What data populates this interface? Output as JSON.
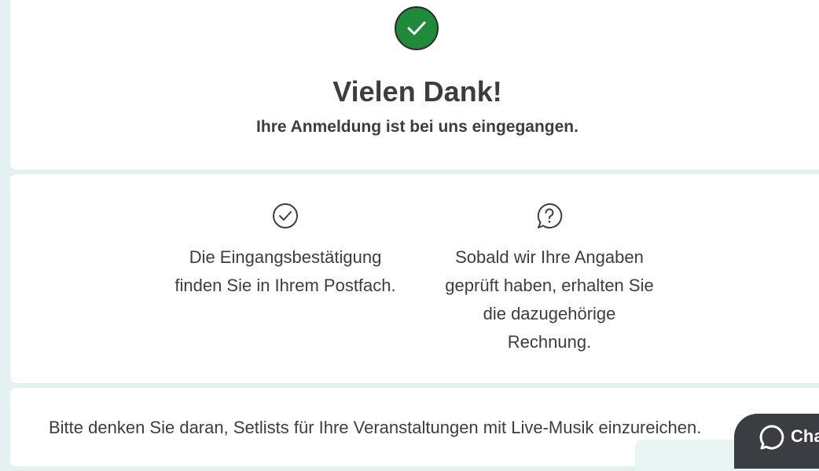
{
  "confirmation": {
    "title": "Vielen Dank!",
    "subtitle": "Ihre Anmeldung ist bei uns eingegangen.",
    "status_icon": "check-circle",
    "status_color": "#1e8a3a"
  },
  "info": [
    {
      "icon": "check-circle-outline",
      "text": "Die Eingangsbestätigung finden Sie in Ihrem Postfach."
    },
    {
      "icon": "question-bubble",
      "text": "Sobald wir Ihre Angaben geprüft haben, erhalten Sie die dazugehörige Rechnung."
    }
  ],
  "notice": "Bitte denken Sie daran, Setlists für Ihre Veranstaltungen mit Live-Musik einzureichen.",
  "chat": {
    "label": "Chat",
    "icon": "chat-bubble"
  }
}
